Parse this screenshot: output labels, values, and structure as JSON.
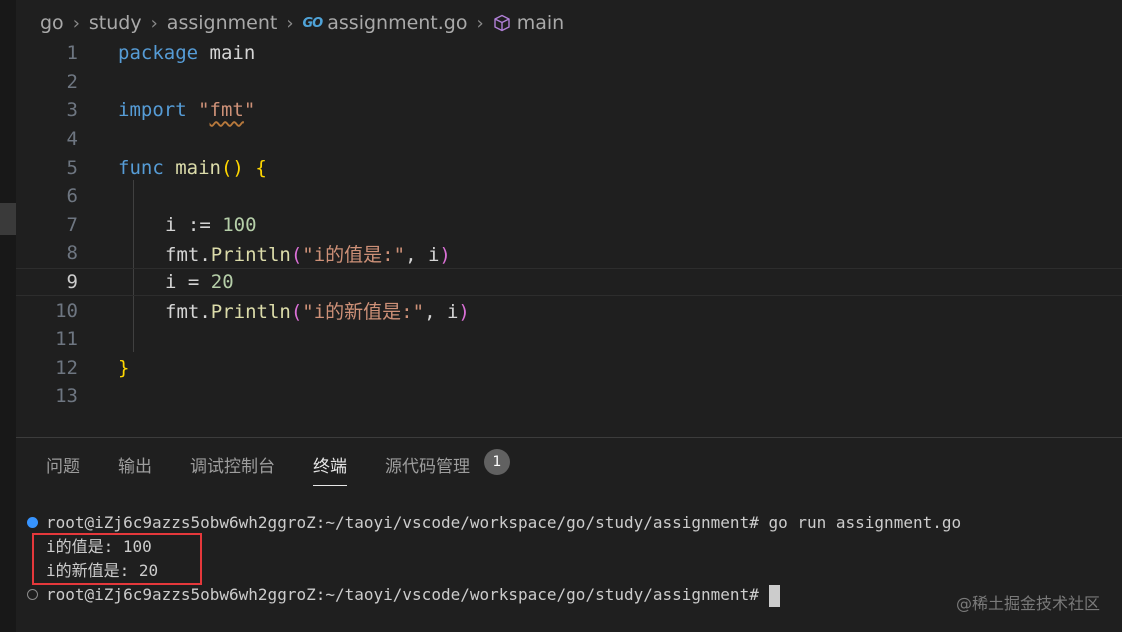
{
  "breadcrumb": {
    "items": [
      "go",
      "study",
      "assignment",
      "assignment.go",
      "main"
    ],
    "go_logo_text": "GO"
  },
  "editor": {
    "current_line": 9,
    "lines": [
      {
        "n": "1"
      },
      {
        "n": "2"
      },
      {
        "n": "3"
      },
      {
        "n": "4"
      },
      {
        "n": "5"
      },
      {
        "n": "6"
      },
      {
        "n": "7"
      },
      {
        "n": "8"
      },
      {
        "n": "9"
      },
      {
        "n": "10"
      },
      {
        "n": "11"
      },
      {
        "n": "12"
      },
      {
        "n": "13"
      }
    ],
    "tokens": {
      "l1": {
        "kw": "package",
        "name": "main"
      },
      "l3": {
        "kw": "import",
        "q1": "\"",
        "pkg": "fmt",
        "q2": "\""
      },
      "l5": {
        "kw": "func",
        "name": "main",
        "parens": "()",
        "brace": "{"
      },
      "l7": {
        "var": "i",
        "op": " := ",
        "num": "100"
      },
      "l8": {
        "obj": "fmt.",
        "fn": "Println",
        "lp": "(",
        "str": "\"i的值是:\"",
        "rest": ", i",
        "rp": ")"
      },
      "l9": {
        "var": "i",
        "op": " = ",
        "num": "20"
      },
      "l10": {
        "obj": "fmt.",
        "fn": "Println",
        "lp": "(",
        "str": "\"i的新值是:\"",
        "rest": ", i",
        "rp": ")"
      },
      "l12": {
        "brace": "}"
      }
    }
  },
  "panel": {
    "tabs": [
      "问题",
      "输出",
      "调试控制台",
      "终端",
      "源代码管理"
    ],
    "active_tab": "终端",
    "scm_badge": "1"
  },
  "terminal": {
    "line1": "root@iZj6c9azzs5obw6wh2ggroZ:~/taoyi/vscode/workspace/go/study/assignment# go run assignment.go",
    "out1": "i的值是: 100",
    "out2": "i的新值是: 20",
    "prompt": "root@iZj6c9azzs5obw6wh2ggroZ:~/taoyi/vscode/workspace/go/study/assignment#"
  },
  "watermark": "@稀土掘金技术社区",
  "colors": {
    "keyword": "#569cd6",
    "function": "#dcdcaa",
    "string": "#ce9178",
    "number": "#b5cea8",
    "accent": "#3794ff"
  }
}
